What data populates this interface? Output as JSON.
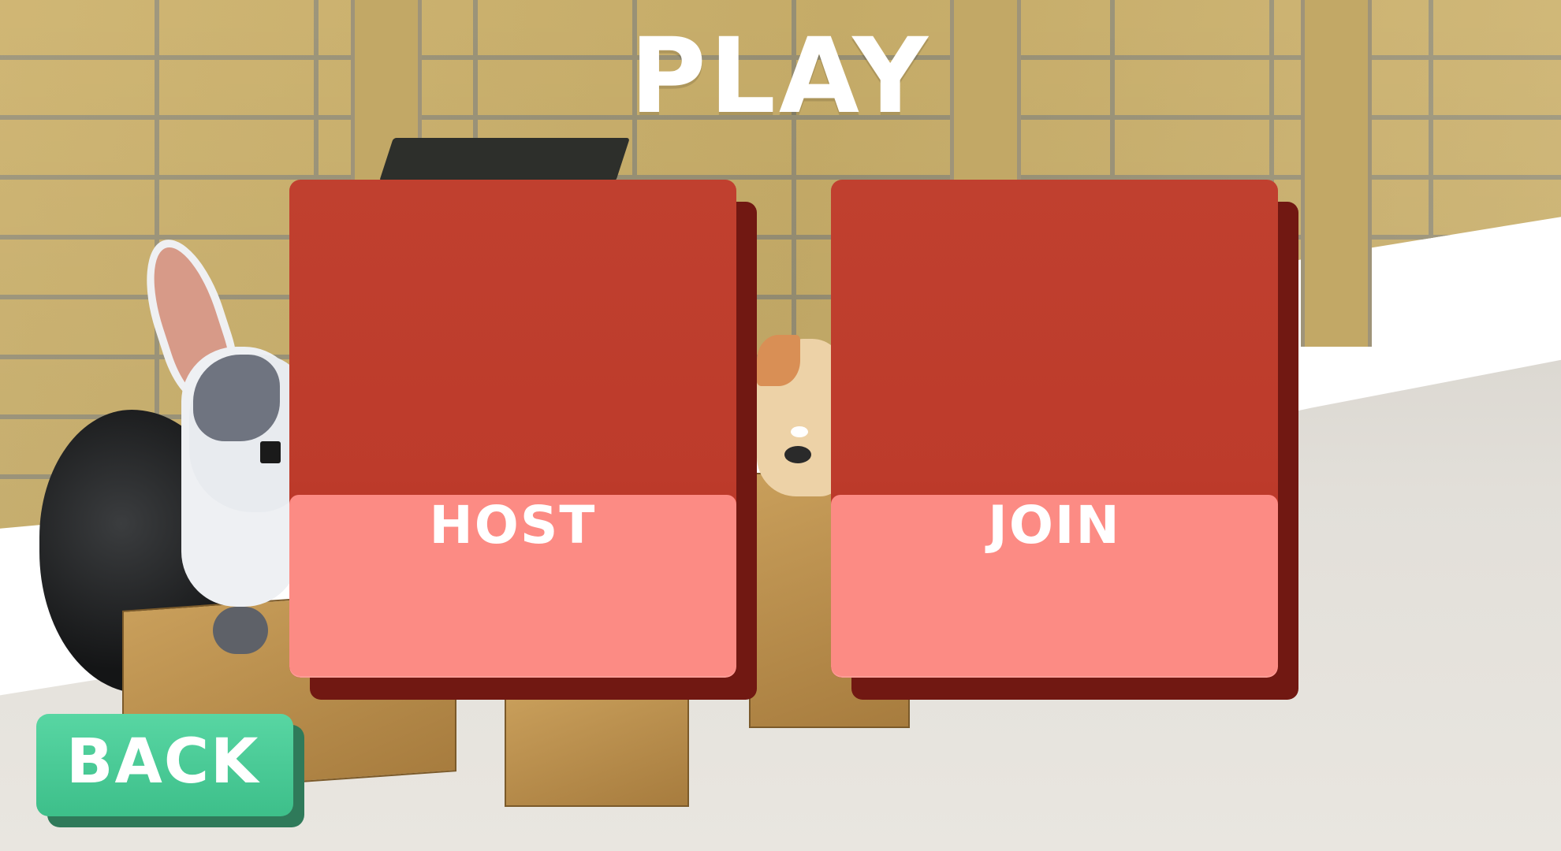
{
  "screen": {
    "title": "PLAY"
  },
  "cards": {
    "host": {
      "label": "HOST"
    },
    "join": {
      "label": "JOIN"
    }
  },
  "back_button": {
    "label": "BACK"
  },
  "colors": {
    "card_top": "#bf3e2e",
    "card_band": "#fc8b84",
    "card_shadow": "#711812",
    "back_button": "#4acb96",
    "title_text": "#ffffff"
  }
}
